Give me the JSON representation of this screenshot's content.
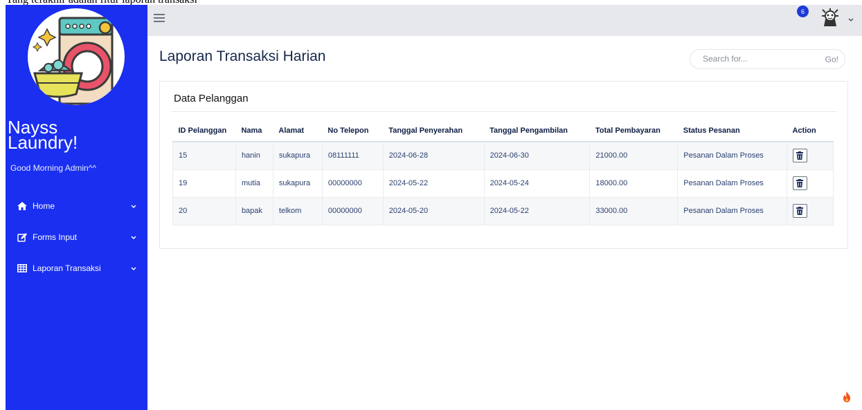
{
  "caption": "Yang terakhir adalah fitur laporan transaksi",
  "sidebar": {
    "brand": "Nayss Laundry!",
    "greeting": "Good Morning Admin^^",
    "items": [
      {
        "label": "Home",
        "icon": "home-icon"
      },
      {
        "label": "Forms Input",
        "icon": "edit-icon"
      },
      {
        "label": "Laporan Transaksi",
        "icon": "table-icon"
      }
    ]
  },
  "topbar": {
    "notification_count": "6"
  },
  "header": {
    "title": "Laporan Transaksi Harian",
    "search_placeholder": "Search for...",
    "search_button": "Go!"
  },
  "card": {
    "title": "Data Pelanggan"
  },
  "table": {
    "columns": [
      "ID Pelanggan",
      "Nama",
      "Alamat",
      "No Telepon",
      "Tanggal Penyerahan",
      "Tanggal Pengambilan",
      "Total Pembayaran",
      "Status Pesanan",
      "Action"
    ],
    "rows": [
      [
        "15",
        "hanin",
        "sukapura",
        "08111111",
        "2024-06-28",
        "2024-06-30",
        "21000.00",
        "Pesanan Dalam Proses"
      ],
      [
        "19",
        "mutia",
        "sukapura",
        "00000000",
        "2024-05-22",
        "2024-05-24",
        "18000.00",
        "Pesanan Dalam Proses"
      ],
      [
        "20",
        "bapak",
        "telkom",
        "00000000",
        "2024-05-20",
        "2024-05-22",
        "33000.00",
        "Pesanan Dalam Proses"
      ]
    ]
  },
  "colors": {
    "sidebar": "#1a2ff0",
    "topbar": "#e7e8ec",
    "title": "#15284a",
    "badge": "#1d3bd8"
  }
}
